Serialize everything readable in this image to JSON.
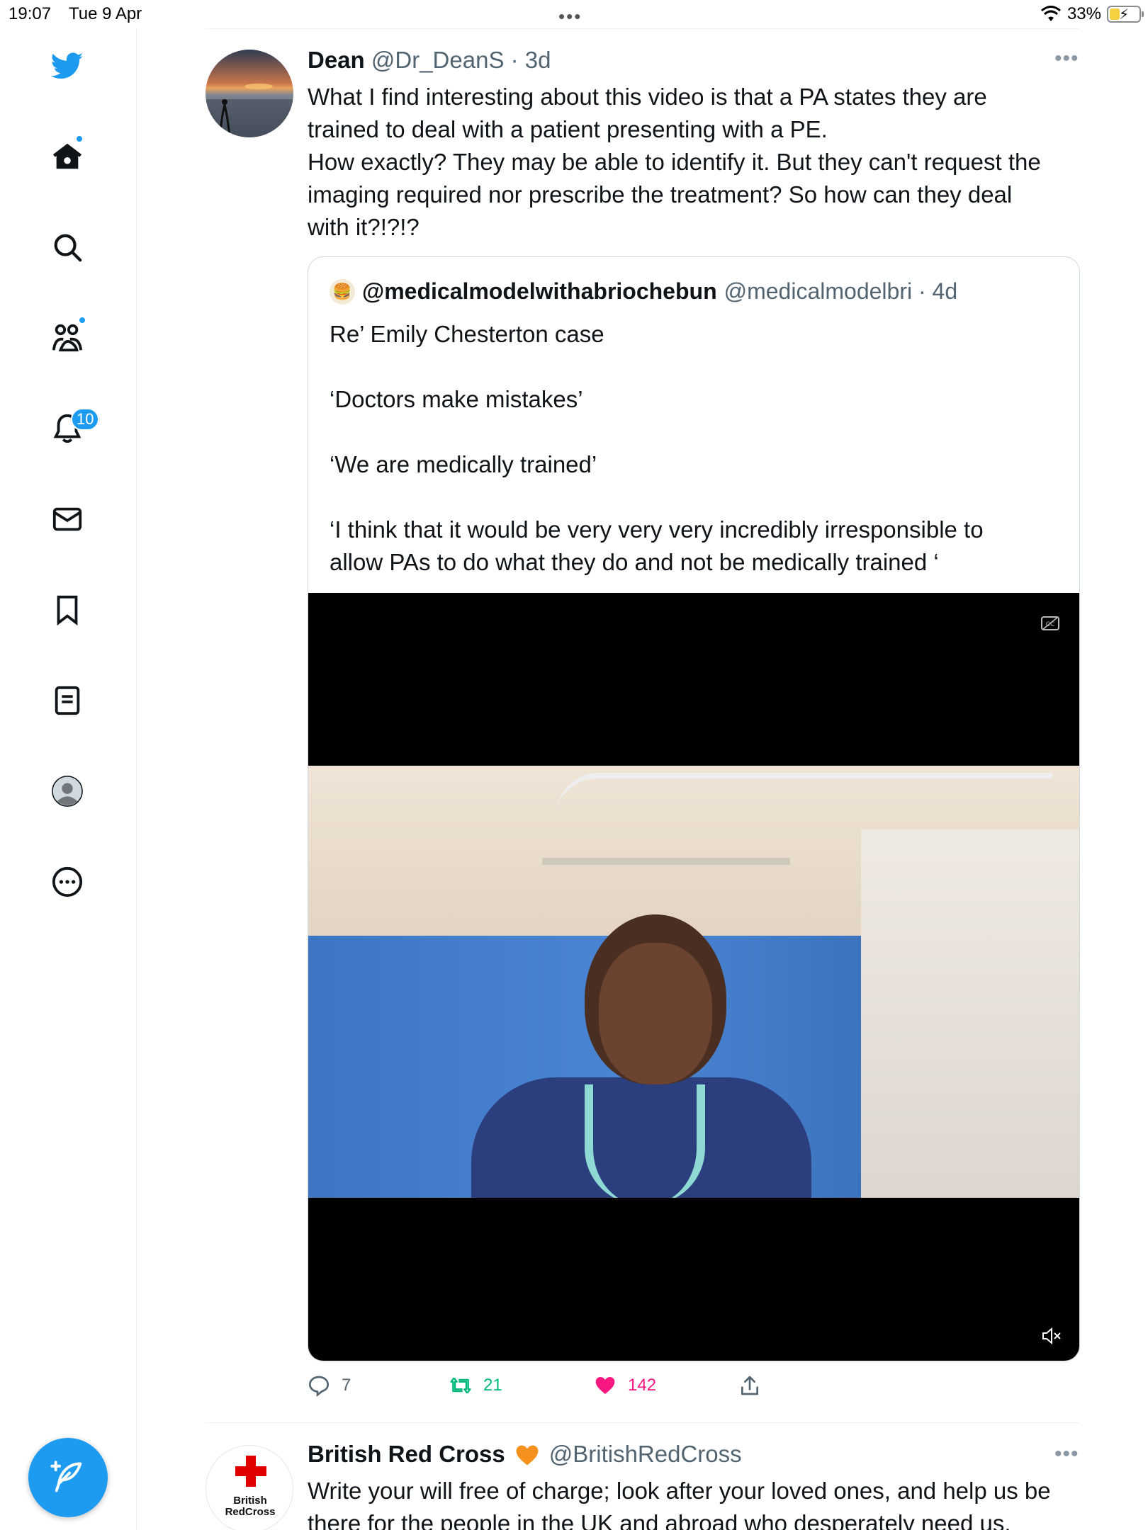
{
  "status": {
    "time": "19:07",
    "date": "Tue 9 Apr",
    "battery": "33%"
  },
  "sidebar": {
    "notifications_badge": "10"
  },
  "tweet": {
    "name": "Dean",
    "handle": "@Dr_DeanS",
    "time": "3d",
    "lines": [
      "What I find interesting about this video is that a PA states they are",
      "trained to deal with a patient presenting with a PE.",
      "How exactly? They may be able to identify it. But they can't request the",
      "imaging required nor prescribe the treatment? So how can they deal",
      "with it?!?!?"
    ],
    "quote": {
      "name": "@medicalmodelwithabriochebun",
      "handle": "@medicalmodelbri",
      "time": "4d",
      "lines": [
        "Re’ Emily Chesterton case",
        "",
        "‘Doctors make mistakes’",
        "",
        "‘We are medically trained’",
        "",
        "‘I think that it would be very very very incredibly irresponsible to",
        "allow PAs to do what they do and not be medically trained ‘"
      ]
    },
    "actions": {
      "replies": "7",
      "retweets": "21",
      "likes": "142"
    }
  },
  "tweet2": {
    "name": "British Red Cross",
    "handle": "@BritishRedCross",
    "avatar_text_line1": "British",
    "avatar_text_line2": "RedCross",
    "lines": [
      "Write your will free of charge; look after your loved ones, and help us be",
      "there for the people in the UK and abroad who desperately need us."
    ]
  },
  "colors": {
    "accent": "#1d9bf0",
    "retweet": "#00ba7c",
    "like": "#f91880",
    "muted_text": "#536471"
  }
}
